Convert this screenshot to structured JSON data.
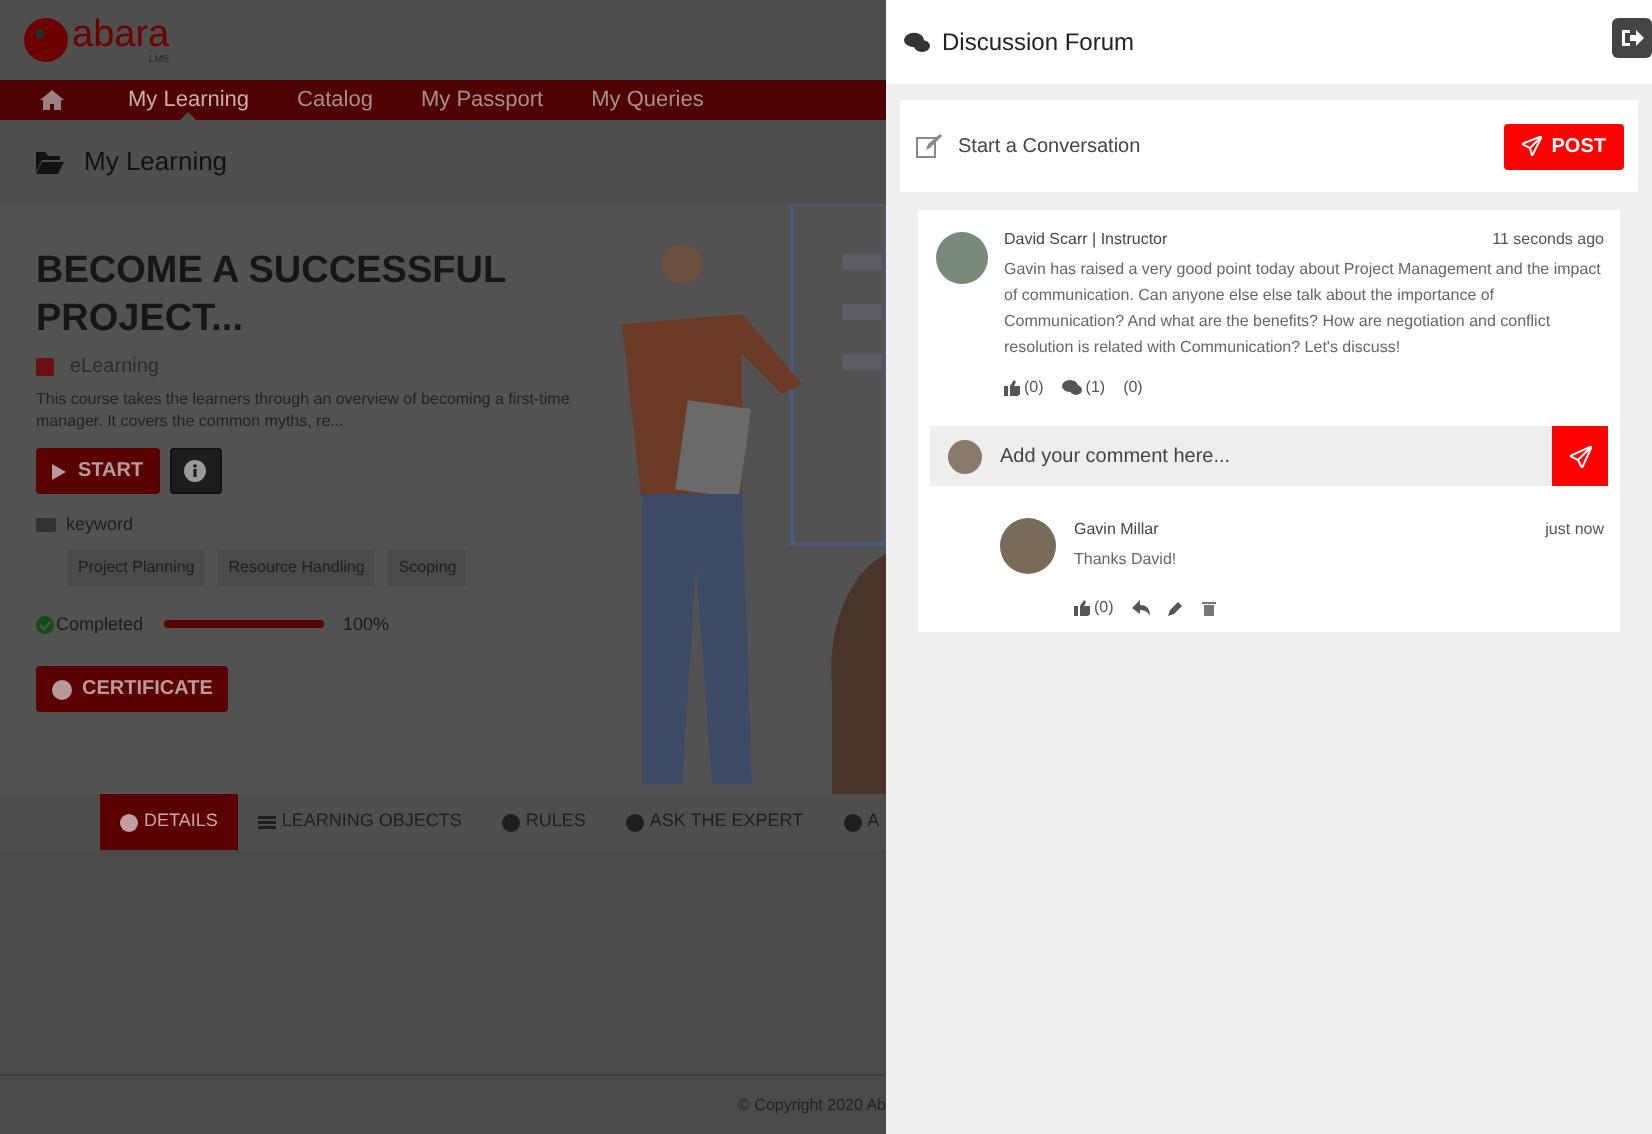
{
  "logo": {
    "text": "abara",
    "sub": "LMS"
  },
  "nav": {
    "items": [
      {
        "label": "My Learning",
        "selected": true
      },
      {
        "label": "Catalog",
        "selected": false
      },
      {
        "label": "My Passport",
        "selected": false
      },
      {
        "label": "My Queries",
        "selected": false
      }
    ]
  },
  "breadcrumb": "My Learning",
  "course": {
    "title": "BECOME A SUCCESSFUL PROJECT...",
    "type": "eLearning",
    "description": "This course takes the learners through an overview of becoming a first-time manager. It covers the common myths, re...",
    "start_label": "START",
    "keyword_label": "keyword",
    "keywords": [
      "Project Planning",
      "Resource Handling",
      "Scoping"
    ],
    "status": "Completed",
    "level": 1,
    "percent": "100%",
    "certificate_label": "CERTIFICATE"
  },
  "tabs": [
    {
      "label": "DETAILS",
      "selected": true
    },
    {
      "label": "LEARNING OBJECTS",
      "selected": false
    },
    {
      "label": "RULES",
      "selected": false
    },
    {
      "label": "ASK THE EXPERT",
      "selected": false
    },
    {
      "label": "A",
      "selected": false
    }
  ],
  "footer": "© Copyright 2020 Ab",
  "forum": {
    "title": "Discussion Forum",
    "start_placeholder": "Start a Conversation",
    "post_label": "POST",
    "post": {
      "author": "David Scarr | Instructor",
      "time": "11 seconds ago",
      "text": "Gavin has raised a very good point today about Project Management and the impact of communication. Can anyone else else talk about the importance of Communication? And what are the benefits? How are negotiation and conflict resolution is related with Communication? Let's discuss!",
      "likes": "(0)",
      "comments": "(1)",
      "other": "(0)"
    },
    "comment_placeholder": "Add your comment here...",
    "replies": [
      {
        "author": "Gavin Millar",
        "time": "just now",
        "text": "Thanks David!",
        "likes": "(0)"
      }
    ]
  }
}
